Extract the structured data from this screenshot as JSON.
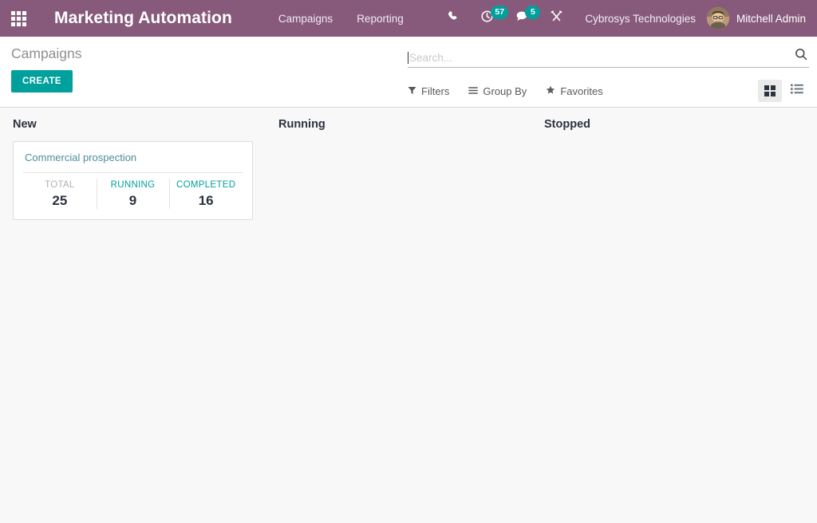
{
  "navbar": {
    "apps_menu": "apps-grid-icon",
    "brand_title": "Marketing Automation",
    "menu_items": [
      {
        "label": "Campaigns"
      },
      {
        "label": "Reporting"
      }
    ],
    "systray": [
      {
        "icon": "phone-icon",
        "name": "voip-phone",
        "badge": null
      },
      {
        "icon": "clock-icon",
        "name": "activities",
        "badge": "57"
      },
      {
        "icon": "chat-icon",
        "name": "messages",
        "badge": "5"
      },
      {
        "icon": "tools-icon",
        "name": "debug-tools",
        "badge": null
      }
    ],
    "company": "Cybrosys Technologies",
    "user_name": "Mitchell Admin"
  },
  "control_panel": {
    "breadcrumb": "Campaigns",
    "create_label": "CREATE",
    "search": {
      "placeholder": "Search...",
      "value": ""
    },
    "filters": [
      {
        "label": "Filters",
        "icon": "funnel-icon"
      },
      {
        "label": "Group By",
        "icon": "hamburger-icon"
      },
      {
        "label": "Favorites",
        "icon": "star-icon"
      }
    ],
    "views": [
      {
        "name": "kanban",
        "icon": "kanban-icon",
        "active": true
      },
      {
        "name": "list",
        "icon": "list-icon",
        "active": false
      }
    ]
  },
  "kanban": {
    "columns": [
      {
        "title": "New",
        "cards": [
          {
            "title": "Commercial prospection",
            "stats": [
              {
                "label": "TOTAL",
                "value": "25",
                "style": "muted"
              },
              {
                "label": "RUNNING",
                "value": "9",
                "style": "link"
              },
              {
                "label": "COMPLETED",
                "value": "16",
                "style": "link"
              }
            ]
          }
        ]
      },
      {
        "title": "Running",
        "cards": []
      },
      {
        "title": "Stopped",
        "cards": []
      }
    ]
  },
  "colors": {
    "brand_purple": "#875A7B",
    "accent_teal": "#00A09D",
    "card_title_link": "#4b8e97",
    "body_bg": "#f8f8f8"
  }
}
